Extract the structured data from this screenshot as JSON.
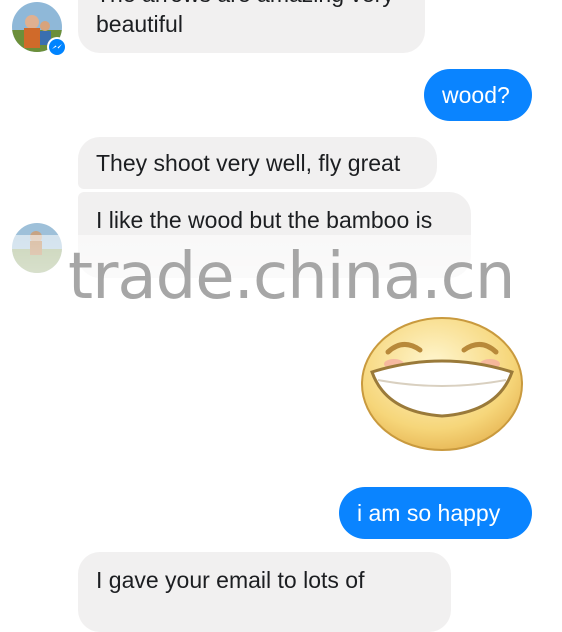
{
  "conversation": {
    "messages": [
      {
        "direction": "incoming",
        "text": "The arrows are amazing very"
      },
      {
        "direction": "incoming",
        "text": "beautiful"
      },
      {
        "direction": "outgoing",
        "text": "wood?"
      },
      {
        "direction": "incoming",
        "text": "They shoot very well, fly great"
      },
      {
        "direction": "incoming",
        "text": "I like the wood but the bamboo is"
      },
      {
        "direction": "outgoing",
        "sticker": "laughing-face-sticker"
      },
      {
        "direction": "outgoing",
        "text": "i am so happy"
      },
      {
        "direction": "incoming",
        "text": "I gave your email to lots of"
      }
    ]
  },
  "watermark": {
    "text": "trade.china.cn"
  },
  "colors": {
    "outgoing_bubble": "#0a84ff",
    "incoming_bubble": "#f1f0f0",
    "messenger_badge": "#0084ff"
  }
}
